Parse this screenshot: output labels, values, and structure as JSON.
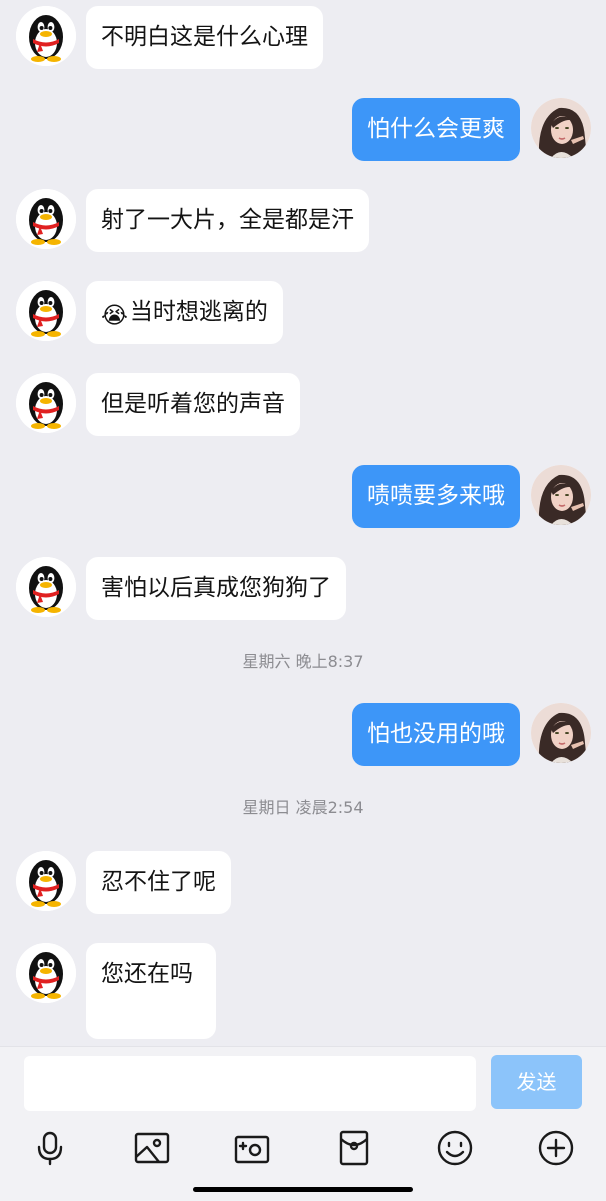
{
  "messages": [
    {
      "side": "in",
      "text": "不明白这是什么心理"
    },
    {
      "side": "out",
      "text": "怕什么会更爽"
    },
    {
      "side": "in",
      "text": "射了一大片，全是都是汗"
    },
    {
      "side": "in",
      "emoji": "😭",
      "text": "当时想逃离的"
    },
    {
      "side": "in",
      "text": "但是听着您的声音"
    },
    {
      "side": "out",
      "text": "啧啧要多来哦"
    },
    {
      "side": "in",
      "text": "害怕以后真成您狗狗了"
    },
    {
      "timestamp": "星期六 晚上8:37"
    },
    {
      "side": "out",
      "text": "怕也没用的哦"
    },
    {
      "timestamp": "星期日 凌晨2:54"
    },
    {
      "side": "in",
      "text": "忍不住了呢"
    },
    {
      "side": "in",
      "text": "您还在吗"
    }
  ],
  "composer": {
    "input_value": "",
    "send_label": "发送"
  },
  "toolbar": {
    "icons": [
      "microphone-icon",
      "photo-icon",
      "camera-icon",
      "red-packet-icon",
      "emoji-icon",
      "plus-icon"
    ]
  },
  "colors": {
    "background": "#ededf2",
    "incoming_bubble": "#ffffff",
    "outgoing_bubble": "#3d96f8",
    "send_button_disabled": "#8cc4fa"
  }
}
